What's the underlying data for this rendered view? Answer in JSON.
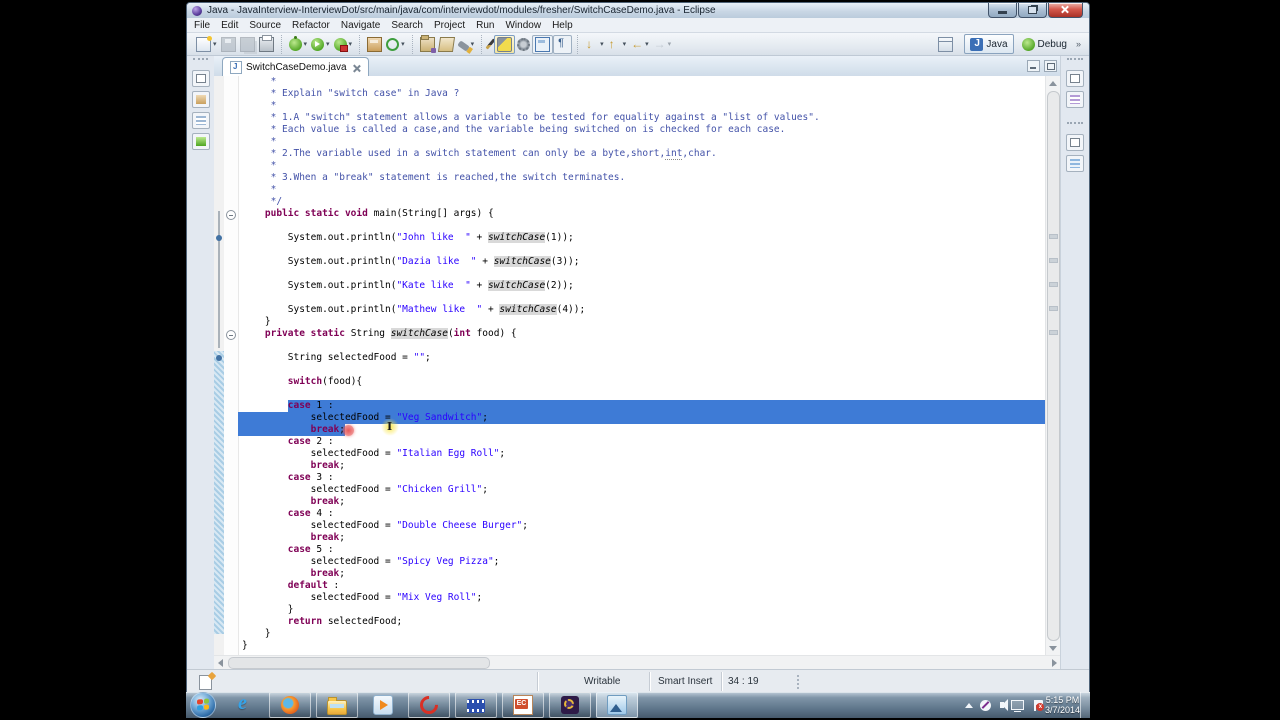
{
  "window": {
    "title": "Java - JavaInterview-InterviewDot/src/main/java/com/interviewdot/modules/fresher/SwitchCaseDemo.java - Eclipse",
    "menu": [
      "File",
      "Edit",
      "Source",
      "Refactor",
      "Navigate",
      "Search",
      "Project",
      "Run",
      "Window",
      "Help"
    ]
  },
  "toolbar": {
    "groups": [
      [
        {
          "name": "new-wizard-button",
          "icon": "new",
          "caret": true
        },
        {
          "name": "save-button",
          "icon": "save",
          "disabled": true
        },
        {
          "name": "save-all-button",
          "icon": "saveall",
          "disabled": true
        },
        {
          "name": "print-button",
          "icon": "print"
        }
      ],
      [
        {
          "name": "debug-button",
          "icon": "debug",
          "caret": true
        },
        {
          "name": "run-button",
          "icon": "run",
          "caret": true
        },
        {
          "name": "external-tools-button",
          "icon": "runext",
          "caret": true
        }
      ],
      [
        {
          "name": "new-java-project-button",
          "icon": "newprj"
        },
        {
          "name": "new-class-button",
          "icon": "newclass",
          "caret": true
        }
      ],
      [
        {
          "name": "open-task-button",
          "icon": "folder1"
        },
        {
          "name": "open-resource-button",
          "icon": "folder2"
        },
        {
          "name": "search-button",
          "icon": "torch",
          "caret": true
        }
      ],
      [
        {
          "name": "last-edit-location-button",
          "icon": "pen"
        },
        {
          "name": "mark-occurrences-toggle",
          "icon": "marker",
          "active": true
        },
        {
          "name": "build-button",
          "icon": "gear"
        },
        {
          "name": "block-selection-toggle",
          "icon": "block",
          "framed": true
        },
        {
          "name": "show-whitespace-toggle",
          "icon": "pilcrow",
          "framed": true
        }
      ],
      [
        {
          "name": "next-annotation-button",
          "icon": "down",
          "caret": true
        },
        {
          "name": "prev-annotation-button",
          "icon": "up",
          "caret": true
        },
        {
          "name": "back-button",
          "icon": "back",
          "caret": true
        },
        {
          "name": "forward-button",
          "icon": "fwd",
          "caret": true,
          "disabled": true
        }
      ]
    ],
    "perspectives": [
      {
        "name": "open-perspective-button",
        "icon": "persp",
        "label": ""
      },
      {
        "name": "perspective-java-button",
        "icon": "javapersp",
        "label": "Java",
        "active": true
      },
      {
        "name": "perspective-debug-button",
        "icon": "debugpersp",
        "label": "Debug"
      }
    ],
    "chevron": "»"
  },
  "editor": {
    "tab": "SwitchCaseDemo.java",
    "gutter": {
      "fold_lines": [
        11,
        21
      ],
      "dot_lines": [
        13,
        23
      ]
    },
    "lines": [
      {
        "s": [
          {
            "c": "com",
            "t": "     *"
          }
        ]
      },
      {
        "s": [
          {
            "c": "com",
            "t": "     * Explain \"switch case\" in Java ?"
          }
        ]
      },
      {
        "s": [
          {
            "c": "com",
            "t": "     *"
          }
        ]
      },
      {
        "s": [
          {
            "c": "com",
            "t": "     * 1.A \"switch\" statement allows a variable to be tested for equality against a \"list of values\"."
          }
        ]
      },
      {
        "s": [
          {
            "c": "com",
            "t": "     * Each value is called a case,and the variable being switched on is checked for each case."
          }
        ]
      },
      {
        "s": [
          {
            "c": "com",
            "t": "     *"
          }
        ]
      },
      {
        "s": [
          {
            "c": "com",
            "t": "     * 2.The variable used in a switch statement can only be a byte,short,"
          },
          {
            "c": "csq",
            "t": "int"
          },
          {
            "c": "com",
            "t": ",char."
          }
        ]
      },
      {
        "s": [
          {
            "c": "com",
            "t": "     *"
          }
        ]
      },
      {
        "s": [
          {
            "c": "com",
            "t": "     * 3.When a \"break\" statement is reached,the switch terminates."
          }
        ]
      },
      {
        "s": [
          {
            "c": "com",
            "t": "     *"
          }
        ]
      },
      {
        "s": [
          {
            "c": "com",
            "t": "     */"
          }
        ]
      },
      {
        "s": [
          {
            "c": "kw",
            "t": "    public static void"
          },
          {
            "c": "pl",
            "t": " main(String[] args) {"
          }
        ]
      },
      {
        "s": []
      },
      {
        "s": [
          {
            "c": "pl",
            "t": "        System.out.println("
          },
          {
            "c": "str",
            "t": "\"John like  \""
          },
          {
            "c": "pl",
            "t": " + "
          },
          {
            "c": "occ",
            "t": "switchCase"
          },
          {
            "c": "pl",
            "t": "(1));"
          }
        ]
      },
      {
        "s": []
      },
      {
        "s": [
          {
            "c": "pl",
            "t": "        System.out.println("
          },
          {
            "c": "str",
            "t": "\"Dazia like  \""
          },
          {
            "c": "pl",
            "t": " + "
          },
          {
            "c": "occ",
            "t": "switchCase"
          },
          {
            "c": "pl",
            "t": "(3));"
          }
        ]
      },
      {
        "s": []
      },
      {
        "s": [
          {
            "c": "pl",
            "t": "        System.out.println("
          },
          {
            "c": "str",
            "t": "\"Kate like  \""
          },
          {
            "c": "pl",
            "t": " + "
          },
          {
            "c": "occ",
            "t": "switchCase"
          },
          {
            "c": "pl",
            "t": "(2));"
          }
        ]
      },
      {
        "s": []
      },
      {
        "s": [
          {
            "c": "pl",
            "t": "        System.out.println("
          },
          {
            "c": "str",
            "t": "\"Mathew like  \""
          },
          {
            "c": "pl",
            "t": " + "
          },
          {
            "c": "occ",
            "t": "switchCase"
          },
          {
            "c": "pl",
            "t": "(4));"
          }
        ]
      },
      {
        "s": [
          {
            "c": "pl",
            "t": "    }"
          }
        ]
      },
      {
        "s": [
          {
            "c": "pl",
            "t": "    "
          },
          {
            "c": "kw",
            "t": "private static"
          },
          {
            "c": "pl",
            "t": " String "
          },
          {
            "c": "occ",
            "t": "switchCase"
          },
          {
            "c": "pl",
            "t": "("
          },
          {
            "c": "kw",
            "t": "int"
          },
          {
            "c": "pl",
            "t": " food) {"
          }
        ]
      },
      {
        "s": []
      },
      {
        "s": [
          {
            "c": "pl",
            "t": "        String selectedFood = "
          },
          {
            "c": "str",
            "t": "\"\""
          },
          {
            "c": "pl",
            "t": ";"
          }
        ]
      },
      {
        "s": []
      },
      {
        "s": [
          {
            "c": "pl",
            "t": "        "
          },
          {
            "c": "kw",
            "t": "switch"
          },
          {
            "c": "pl",
            "t": "(food){"
          }
        ]
      },
      {
        "s": []
      },
      {
        "sel": "a",
        "s": [
          {
            "c": "pl",
            "t": "        "
          },
          {
            "c": "kw",
            "t": "case"
          },
          {
            "c": "pl",
            "t": " 1 :"
          }
        ]
      },
      {
        "sel": "f",
        "s": [
          {
            "c": "pl",
            "t": "            selectedFood = "
          },
          {
            "c": "str",
            "t": "\"Veg Sandwitch\""
          },
          {
            "c": "pl",
            "t": ";"
          }
        ]
      },
      {
        "sel": "t",
        "s": [
          {
            "c": "pl",
            "t": "            "
          },
          {
            "c": "kw",
            "t": "break"
          },
          {
            "c": "pl",
            "t": ";"
          }
        ]
      },
      {
        "s": [
          {
            "c": "pl",
            "t": "        "
          },
          {
            "c": "kw",
            "t": "case"
          },
          {
            "c": "pl",
            "t": " 2 :"
          }
        ]
      },
      {
        "s": [
          {
            "c": "pl",
            "t": "            selectedFood = "
          },
          {
            "c": "str",
            "t": "\"Italian Egg Roll\""
          },
          {
            "c": "pl",
            "t": ";"
          }
        ]
      },
      {
        "s": [
          {
            "c": "pl",
            "t": "            "
          },
          {
            "c": "kw",
            "t": "break"
          },
          {
            "c": "pl",
            "t": ";"
          }
        ]
      },
      {
        "s": [
          {
            "c": "pl",
            "t": "        "
          },
          {
            "c": "kw",
            "t": "case"
          },
          {
            "c": "pl",
            "t": " 3 :"
          }
        ]
      },
      {
        "s": [
          {
            "c": "pl",
            "t": "            selectedFood = "
          },
          {
            "c": "str",
            "t": "\"Chicken Grill\""
          },
          {
            "c": "pl",
            "t": ";"
          }
        ]
      },
      {
        "s": [
          {
            "c": "pl",
            "t": "            "
          },
          {
            "c": "kw",
            "t": "break"
          },
          {
            "c": "pl",
            "t": ";"
          }
        ]
      },
      {
        "s": [
          {
            "c": "pl",
            "t": "        "
          },
          {
            "c": "kw",
            "t": "case"
          },
          {
            "c": "pl",
            "t": " 4 :"
          }
        ]
      },
      {
        "s": [
          {
            "c": "pl",
            "t": "            selectedFood = "
          },
          {
            "c": "str",
            "t": "\"Double Cheese Burger\""
          },
          {
            "c": "pl",
            "t": ";"
          }
        ]
      },
      {
        "s": [
          {
            "c": "pl",
            "t": "            "
          },
          {
            "c": "kw",
            "t": "break"
          },
          {
            "c": "pl",
            "t": ";"
          }
        ]
      },
      {
        "s": [
          {
            "c": "pl",
            "t": "        "
          },
          {
            "c": "kw",
            "t": "case"
          },
          {
            "c": "pl",
            "t": " 5 :"
          }
        ]
      },
      {
        "s": [
          {
            "c": "pl",
            "t": "            selectedFood = "
          },
          {
            "c": "str",
            "t": "\"Spicy Veg Pizza\""
          },
          {
            "c": "pl",
            "t": ";"
          }
        ]
      },
      {
        "s": [
          {
            "c": "pl",
            "t": "            "
          },
          {
            "c": "kw",
            "t": "break"
          },
          {
            "c": "pl",
            "t": ";"
          }
        ]
      },
      {
        "s": [
          {
            "c": "pl",
            "t": "        "
          },
          {
            "c": "kw",
            "t": "default"
          },
          {
            "c": "pl",
            "t": " :"
          }
        ]
      },
      {
        "s": [
          {
            "c": "pl",
            "t": "            selectedFood = "
          },
          {
            "c": "str",
            "t": "\"Mix Veg Roll\""
          },
          {
            "c": "pl",
            "t": ";"
          }
        ]
      },
      {
        "s": [
          {
            "c": "pl",
            "t": "        }"
          }
        ]
      },
      {
        "s": [
          {
            "c": "pl",
            "t": "        "
          },
          {
            "c": "kw",
            "t": "return"
          },
          {
            "c": "pl",
            "t": " selectedFood;"
          }
        ]
      },
      {
        "s": [
          {
            "c": "pl",
            "t": "    }"
          }
        ]
      },
      {
        "s": [
          {
            "c": "pl",
            "t": "}"
          }
        ]
      }
    ]
  },
  "statusbar": {
    "writable": "Writable",
    "insert_mode": "Smart Insert",
    "caret_position": "34 : 19"
  },
  "taskbar": {
    "items": [
      {
        "id": "internet-explorer"
      },
      {
        "id": "firefox",
        "framed": true
      },
      {
        "id": "windows-explorer",
        "framed": true
      },
      {
        "id": "media-player"
      },
      {
        "id": "swirl",
        "framed": true
      },
      {
        "id": "movie-maker",
        "framed": true
      },
      {
        "id": "office",
        "framed": true
      },
      {
        "id": "eclipse",
        "framed": true
      },
      {
        "id": "image-viewer",
        "framed": true,
        "active": true
      }
    ],
    "clock_time": "5:15 PM",
    "clock_date": "3/7/2014"
  },
  "colors": {
    "selection": "#3E7BD6",
    "keyword": "#7F0055",
    "string": "#2A00FF",
    "comment": "#4352A8",
    "occurrence_bg": "#D9D9D9"
  },
  "icons": {
    "caret": "▾",
    "chevron": "»"
  }
}
